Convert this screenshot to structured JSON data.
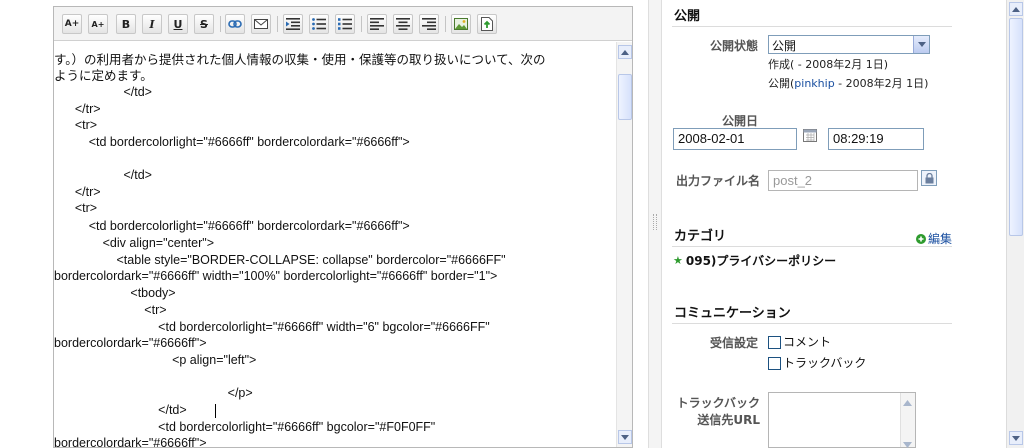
{
  "toolbar": {
    "buttons": [
      {
        "name": "increase-font-size",
        "glyph": "A+"
      },
      {
        "name": "decrease-font-size",
        "glyph": "A+"
      },
      {
        "name": "bold",
        "glyph": "B"
      },
      {
        "name": "italic",
        "glyph": "I"
      },
      {
        "name": "underline",
        "glyph": "U"
      },
      {
        "name": "strikethrough",
        "glyph": "S"
      },
      {
        "name": "link",
        "glyph": "link-icon"
      },
      {
        "name": "email",
        "glyph": "envelope-icon"
      },
      {
        "name": "indent",
        "glyph": "indent-icon"
      },
      {
        "name": "bullet-list",
        "glyph": "bullet-list-icon"
      },
      {
        "name": "numbered-list",
        "glyph": "numbered-list-icon"
      },
      {
        "name": "align-left",
        "glyph": "align-left-icon"
      },
      {
        "name": "align-center",
        "glyph": "align-center-icon"
      },
      {
        "name": "align-right",
        "glyph": "align-right-icon"
      },
      {
        "name": "insert-image",
        "glyph": "image-icon"
      },
      {
        "name": "upload-file",
        "glyph": "upload-icon"
      }
    ]
  },
  "editor": {
    "lines": [
      "す。）の利用者から提供された個人情報の収集・使用・保護等の取り扱いについて、次の",
      "ように定めます。",
      "                    </td>",
      "      </tr>",
      "      <tr>",
      "          <td bordercolorlight=\"#6666ff\" bordercolordark=\"#6666ff\">",
      "",
      "                    </td>",
      "      </tr>",
      "      <tr>",
      "          <td bordercolorlight=\"#6666ff\" bordercolordark=\"#6666ff\">",
      "              <div align=\"center\">",
      "                  <table style=\"BORDER-COLLAPSE: collapse\" bordercolor=\"#6666FF\"",
      "bordercolordark=\"#6666ff\" width=\"100%\" bordercolorlight=\"#6666ff\" border=\"1\">",
      "                      <tbody>",
      "                          <tr>",
      "                              <td bordercolorlight=\"#6666ff\" width=\"6\" bgcolor=\"#6666FF\"",
      "bordercolordark=\"#6666ff\">",
      "                                  <p align=\"left\">",
      "",
      "                                                  </p>",
      "                              </td>",
      "                              <td bordercolorlight=\"#6666ff\" bgcolor=\"#F0F0FF\"",
      "bordercolordark=\"#6666ff\">"
    ]
  },
  "publish": {
    "title": "公開",
    "status_label": "公開状態",
    "status_value": "公開",
    "created_text": "作成( - 2008年2月 1日)",
    "published_prefix": "公開(",
    "published_user": "pinkhip",
    "published_suffix": " - 2008年2月 1日)",
    "date_label": "公開日",
    "date_value": "2008-02-01",
    "time_value": "08:29:19",
    "filename_label": "出力ファイル名",
    "filename_value": "post_2"
  },
  "category": {
    "title": "カテゴリ",
    "edit_label": "編集",
    "item": "095)プライバシーポリシー"
  },
  "communication": {
    "title": "コミュニケーション",
    "receive_label": "受信設定",
    "comment_label": "コメント",
    "trackback_label": "トラックバック",
    "trackback_url_label_1": "トラックバック",
    "trackback_url_label_2": "送信先URL"
  },
  "colors": {
    "accent_link": "#1a4fa0",
    "star_green": "#2e9b2e",
    "plus_green": "#2e9b2e"
  }
}
